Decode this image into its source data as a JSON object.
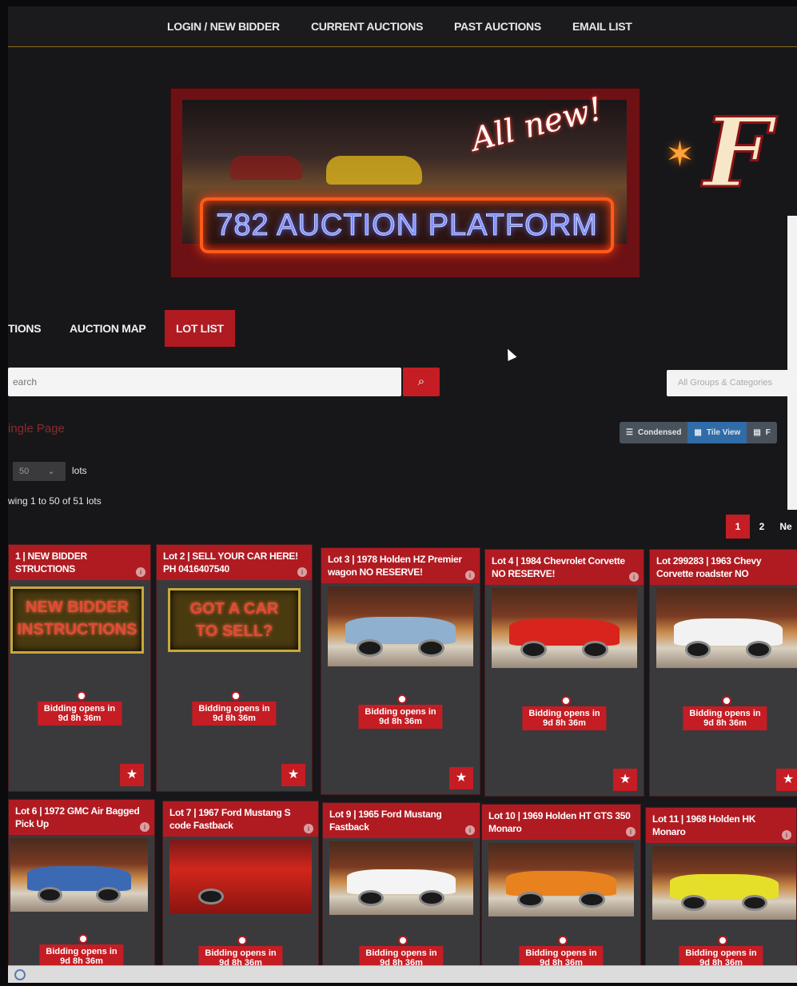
{
  "topnav": {
    "items": [
      "LOGIN / NEW BIDDER",
      "CURRENT AUCTIONS",
      "PAST AUCTIONS",
      "EMAIL LIST"
    ]
  },
  "banner": {
    "tagline": "All new!",
    "title": "782 AUCTION PLATFORM"
  },
  "side_logo": {
    "text": "F"
  },
  "subnav": {
    "tabs": [
      "TIONS",
      "AUCTION MAP",
      "LOT LIST"
    ],
    "active": "LOT LIST"
  },
  "search": {
    "placeholder": "earch"
  },
  "filter": {
    "groups_placeholder": "All Groups & Categories"
  },
  "single_page": "ingle Page",
  "views": [
    "Condensed",
    "Tile View",
    "F"
  ],
  "per_page": {
    "value": "50",
    "label": "lots"
  },
  "showing": "wing 1 to 50 of 51 lots",
  "pagination": [
    "1",
    "2",
    "Ne"
  ],
  "bid_status": "Bidding opens in",
  "bid_time": "9d 8h 36m",
  "colors": {
    "accent": "#b01b22",
    "button": "#c41d24",
    "view_active": "#2f6ca8"
  },
  "lots_row1": [
    {
      "title": "1 | NEW BIDDER\nSTRUCTIONS",
      "sign1": "NEW BIDDER",
      "sign2": "INSTRUCTIONS"
    },
    {
      "title": "Lot 2 | SELL YOUR CAR HERE! PH 0416407540",
      "sign1": "GOT A CAR",
      "sign2": "TO SELL?"
    },
    {
      "title": "Lot 3 | 1978 Holden HZ Premier wagon NO RESERVE!"
    },
    {
      "title": "Lot 4 | 1984 Chevrolet Corvette NO RESERVE!"
    },
    {
      "title": "Lot 299283 | 1963 Chevy Corvette roadster NO"
    }
  ],
  "lots_row2": [
    {
      "title": "Lot 6 | 1972 GMC Air Bagged Pick Up"
    },
    {
      "title": "Lot 7 | 1967 Ford Mustang S code Fastback"
    },
    {
      "title": "Lot 9 | 1965 Ford Mustang Fastback"
    },
    {
      "title": "Lot 10 | 1969 Holden HT GTS 350 Monaro"
    },
    {
      "title": "Lot 11 | 1968 Holden HK Monaro"
    }
  ]
}
